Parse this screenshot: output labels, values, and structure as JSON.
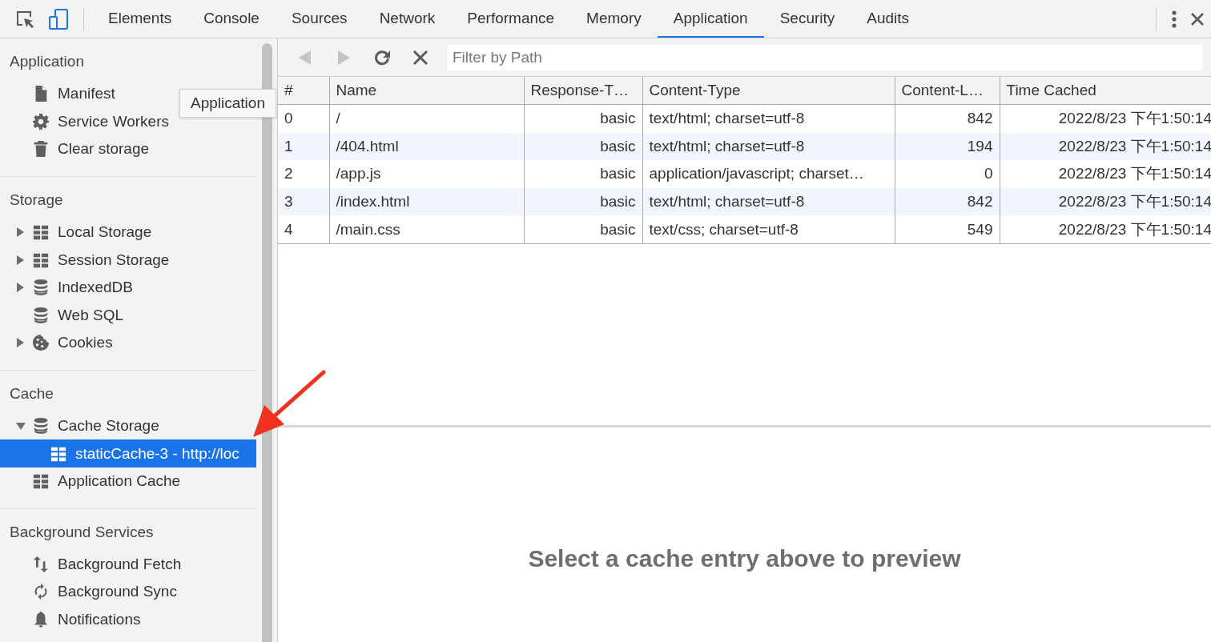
{
  "toolbar": {
    "toggles": [
      {
        "kind": "inspect",
        "on": false
      },
      {
        "kind": "device",
        "on": true
      }
    ]
  },
  "tabs": [
    {
      "label": "Elements",
      "selected": false
    },
    {
      "label": "Console",
      "selected": false
    },
    {
      "label": "Sources",
      "selected": false
    },
    {
      "label": "Network",
      "selected": false
    },
    {
      "label": "Performance",
      "selected": false
    },
    {
      "label": "Memory",
      "selected": false
    },
    {
      "label": "Application",
      "selected": true
    },
    {
      "label": "Security",
      "selected": false
    },
    {
      "label": "Audits",
      "selected": false
    }
  ],
  "sidebar": {
    "sections": [
      {
        "title": "Application",
        "items": [
          {
            "label": "Manifest",
            "kind": "file",
            "selected": false
          },
          {
            "label": "Service Workers",
            "kind": "gear",
            "selected": false
          },
          {
            "label": "Clear storage",
            "kind": "trash",
            "selected": false
          }
        ]
      },
      {
        "title": "Storage",
        "items": [
          {
            "label": "Local Storage",
            "kind": "grid",
            "expanded": false,
            "selected": false
          },
          {
            "label": "Session Storage",
            "kind": "grid",
            "expanded": false,
            "selected": false
          },
          {
            "label": "IndexedDB",
            "kind": "db",
            "expanded": false,
            "selected": false
          },
          {
            "label": "Web SQL",
            "kind": "db",
            "selected": false
          },
          {
            "label": "Cookies",
            "kind": "cookie",
            "expanded": false,
            "selected": false
          }
        ]
      },
      {
        "title": "Cache",
        "items": [
          {
            "label": "Cache Storage",
            "kind": "db",
            "expanded": true,
            "selected": false,
            "children": [
              {
                "label": "staticCache-3 - http://loc",
                "kind": "grid",
                "selected": true
              }
            ]
          },
          {
            "label": "Application Cache",
            "kind": "grid",
            "selected": false
          }
        ]
      },
      {
        "title": "Background Services",
        "items": [
          {
            "label": "Background Fetch",
            "kind": "updown",
            "selected": false
          },
          {
            "label": "Background Sync",
            "kind": "sync",
            "selected": false
          },
          {
            "label": "Notifications",
            "kind": "bell",
            "selected": false
          }
        ]
      }
    ]
  },
  "tooltip": "Application",
  "cache_toolbar": {
    "back_disabled": true,
    "forward_disabled": true,
    "filter": {
      "placeholder": "Filter by Path"
    }
  },
  "table": {
    "columns": [
      "#",
      "Name",
      "Response-T…",
      "Content-Type",
      "Content-L…",
      "Time Cached"
    ],
    "rows": [
      [
        "0",
        "/",
        "basic",
        "text/html; charset=utf-8",
        "842",
        "2022/8/23 下午1:50:14"
      ],
      [
        "1",
        "/404.html",
        "basic",
        "text/html; charset=utf-8",
        "194",
        "2022/8/23 下午1:50:14"
      ],
      [
        "2",
        "/app.js",
        "basic",
        "application/javascript; charset…",
        "0",
        "2022/8/23 下午1:50:14"
      ],
      [
        "3",
        "/index.html",
        "basic",
        "text/html; charset=utf-8",
        "842",
        "2022/8/23 下午1:50:14"
      ],
      [
        "4",
        "/main.css",
        "basic",
        "text/css; charset=utf-8",
        "549",
        "2022/8/23 下午1:50:14"
      ]
    ]
  },
  "preview": {
    "message": "Select a cache entry above to preview"
  }
}
